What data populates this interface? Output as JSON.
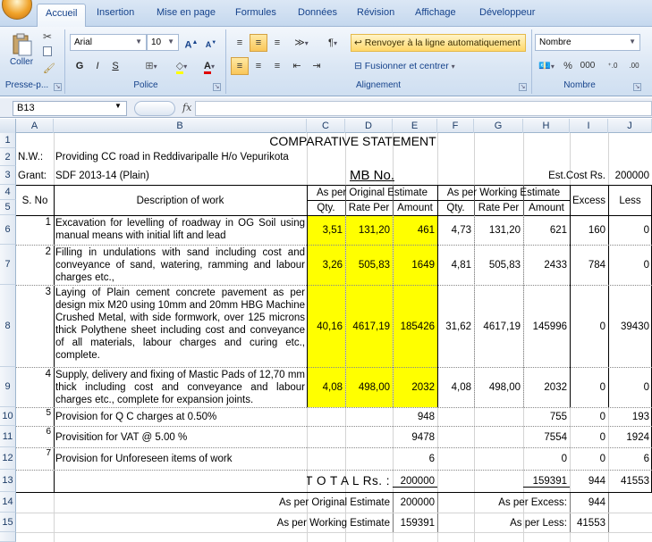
{
  "ribbon": {
    "tabs": [
      "Accueil",
      "Insertion",
      "Mise en page",
      "Formules",
      "Données",
      "Révision",
      "Affichage",
      "Développeur"
    ],
    "clipboard": {
      "paste": "Coller",
      "group": "Presse-p..."
    },
    "font": {
      "name": "Arial",
      "size": "10",
      "bold": "G",
      "italic": "I",
      "underline": "S",
      "group": "Police"
    },
    "alignment": {
      "wrap": "Renvoyer à la ligne automatiquement",
      "merge": "Fusionner et centrer",
      "group": "Alignement"
    },
    "number": {
      "format": "Nombre",
      "percent": "%",
      "thousands": "000",
      "group": "Nombre"
    }
  },
  "formula_bar": {
    "name_box": "B13",
    "fx": "fx",
    "value": ""
  },
  "columns": [
    "A",
    "B",
    "C",
    "D",
    "E",
    "F",
    "G",
    "H",
    "I",
    "J"
  ],
  "rows": [
    "1",
    "2",
    "3",
    "4",
    "5",
    "6",
    "7",
    "8",
    "9",
    "10",
    "11",
    "12",
    "13",
    "14",
    "15"
  ],
  "sheet": {
    "title": "COMPARATIVE STATEMENT",
    "nw_label": "N.W.:",
    "nw_value": "Providing CC road in Reddivaripalle  H/o Vepurikota",
    "grant_label": "Grant:",
    "grant_value": "SDF 2013-14 (Plain)",
    "mb_no": "MB No.",
    "est_cost_label": "Est.Cost Rs.",
    "est_cost_value": "200000",
    "headers": {
      "sno": "S. No",
      "desc": "Description of work",
      "orig": "As per Original Estimate",
      "working": "As per Working Estimate",
      "excess": "Excess",
      "less": "Less",
      "qty": "Qty.",
      "rate": "Rate Per",
      "amount": "Amount"
    },
    "items": [
      {
        "no": "1",
        "desc": "Excavation for levelling of roadway in OG Soil using manual means with initial lift and lead",
        "oq": "3,51",
        "or": "131,20",
        "oa": "461",
        "wq": "4,73",
        "wr": "131,20",
        "wa": "621",
        "ex": "160",
        "ls": "0"
      },
      {
        "no": "2",
        "desc": "Filling in undulations with sand including cost and conveyance of sand, watering, ramming and labour charges etc.,",
        "oq": "3,26",
        "or": "505,83",
        "oa": "1649",
        "wq": "4,81",
        "wr": "505,83",
        "wa": "2433",
        "ex": "784",
        "ls": "0"
      },
      {
        "no": "3",
        "desc": "Laying of Plain cement concrete pavement as per design mix M20 using 10mm and 20mm HBG Machine Crushed Metal, with side formwork, over 125 microns thick Polythene sheet including cost and conveyance of all materials, labour charges and curing etc., complete.",
        "oq": "40,16",
        "or": "4617,19",
        "oa": "185426",
        "wq": "31,62",
        "wr": "4617,19",
        "wa": "145996",
        "ex": "0",
        "ls": "39430"
      },
      {
        "no": "4",
        "desc": "Supply, delivery and fixing of Mastic Pads of 12,70 mm thick including cost and conveyance and labour charges etc., complete for expansion joints.",
        "oq": "4,08",
        "or": "498,00",
        "oa": "2032",
        "wq": "4,08",
        "wr": "498,00",
        "wa": "2032",
        "ex": "0",
        "ls": "0"
      },
      {
        "no": "5",
        "desc": "Provision for Q C charges at 0.50%",
        "oa": "948",
        "wa": "755",
        "ex": "0",
        "ls": "193"
      },
      {
        "no": "6",
        "desc": "Provisition for VAT @ 5.00 %",
        "oa": "9478",
        "wa": "7554",
        "ex": "0",
        "ls": "1924"
      },
      {
        "no": "7",
        "desc": "Provision for Unforeseen items of work",
        "oa": "6",
        "wa": "0",
        "ex": "0",
        "ls": "6"
      }
    ],
    "total": {
      "label": "T O T A L Rs. :",
      "oa": "200000",
      "wa": "159391",
      "ex": "944",
      "ls": "41553"
    },
    "summary": {
      "orig_label": "As per Original Estimate",
      "orig_value": "200000",
      "working_label": "As per Working Estimate",
      "working_value": "159391",
      "excess_label": "As per Excess:",
      "excess_value": "944",
      "less_label": "As per Less:",
      "less_value": "41553"
    }
  }
}
